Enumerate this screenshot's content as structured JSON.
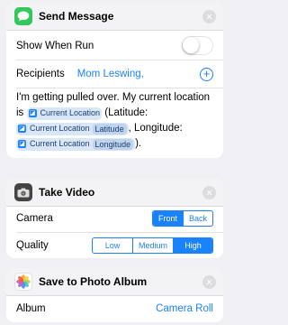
{
  "send_message": {
    "title": "Send Message",
    "show_when_run": {
      "label": "Show When Run",
      "enabled": false
    },
    "recipients": {
      "label": "Recipients",
      "value": "Mom Leswing,",
      "add_icon": "plus-circle-icon"
    },
    "message": {
      "text_1": "I'm getting pulled over. My current location is",
      "token_1": "Current Location",
      "text_2": "(Latitude:",
      "token_2": "Current Location",
      "token_2_prop": "Latitude",
      "text_3": ", Longitude:",
      "token_3": "Current Location",
      "token_3_prop": "Longitude",
      "text_4": ")."
    }
  },
  "take_video": {
    "title": "Take Video",
    "camera": {
      "label": "Camera",
      "options": [
        "Front",
        "Back"
      ],
      "selected": "Front"
    },
    "quality": {
      "label": "Quality",
      "options": [
        "Low",
        "Medium",
        "High"
      ],
      "selected": "High"
    }
  },
  "save_to_album": {
    "title": "Save to Photo Album",
    "album": {
      "label": "Album",
      "value": "Camera Roll"
    }
  },
  "colors": {
    "accent": "#1a82fb",
    "messages_green": "#34c759",
    "background": "#efeff4"
  }
}
